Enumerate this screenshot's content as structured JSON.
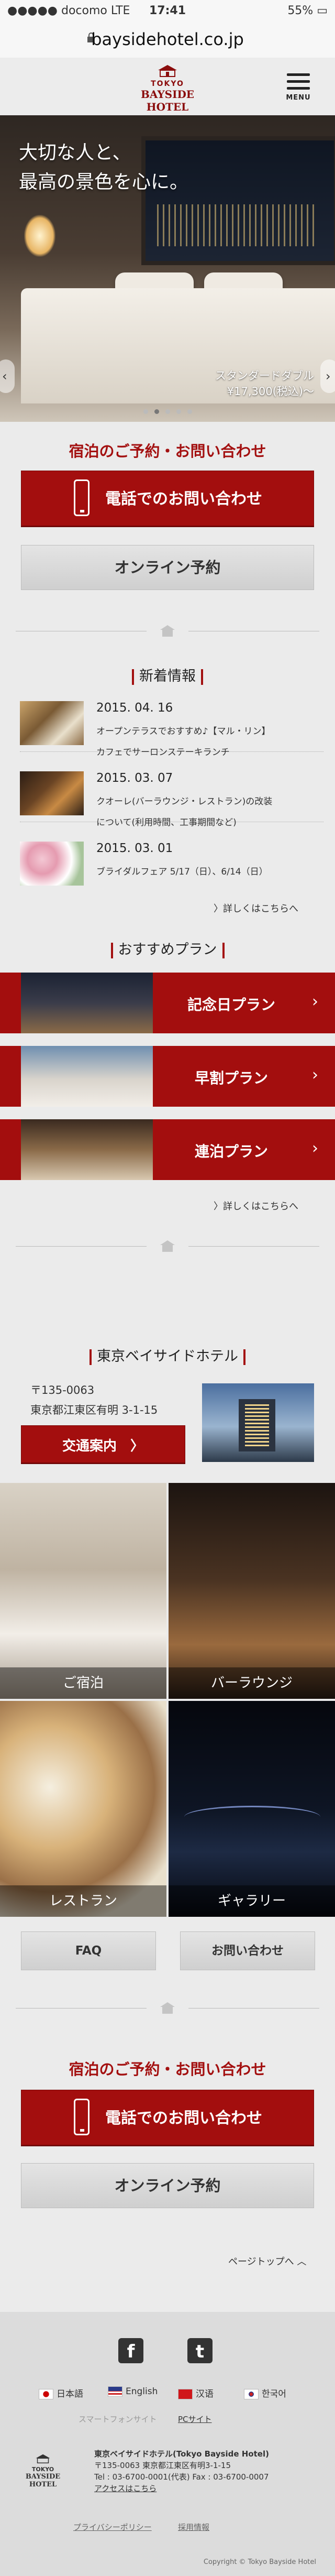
{
  "status": {
    "carrier": "●●●●● docomo",
    "network": "LTE",
    "time": "17:41",
    "battery": "55%"
  },
  "browser": {
    "url": "baysidehotel.co.jp"
  },
  "header": {
    "logo_top": "TOKYO",
    "logo_name": "BAYSIDE HOTEL",
    "menu_label": "MENU"
  },
  "hero": {
    "copy_line1": "大切な人と、",
    "copy_line2": "最高の景色を心に。",
    "room_name": "スタンダードダブル",
    "room_price": "¥17,300(税込)〜",
    "slide_count": 5,
    "active_slide": 1
  },
  "reserve": {
    "title": "宿泊のご予約・お問い合わせ",
    "phone_label": "電話でのお問い合わせ",
    "online_label": "オンライン予約"
  },
  "news": {
    "title": "新着情報",
    "more": "〉詳しくはこちらへ",
    "items": [
      {
        "date": "2015. 04. 16",
        "line1": "オープンテラスでおすすめ♪【マル・リン】",
        "line2": "カフェでサーロンステーキランチ"
      },
      {
        "date": "2015. 03. 07",
        "line1": "クオーレ(バーラウンジ・レストラン)の改装",
        "line2": "について(利用時間、工事期間など)"
      },
      {
        "date": "2015. 03. 01",
        "line1": "ブライダルフェア 5/17（日）、6/14（日）",
        "line2": ""
      }
    ]
  },
  "plans": {
    "title": "おすすめプラン",
    "more": "〉詳しくはこちらへ",
    "items": [
      {
        "label": "記念日プラン"
      },
      {
        "label": "早割プラン"
      },
      {
        "label": "連泊プラン"
      }
    ]
  },
  "hotel": {
    "title": "東京ベイサイドホテル",
    "postal": "〒135-0063",
    "address": "東京都江東区有明 3-1-15",
    "access_label": "交通案内",
    "chevron": "〉",
    "tiles": [
      {
        "label": "ご宿泊"
      },
      {
        "label": "バーラウンジ"
      },
      {
        "label": "レストラン"
      },
      {
        "label": "ギャラリー"
      }
    ]
  },
  "links": {
    "faq": "FAQ",
    "contact": "お問い合わせ"
  },
  "reserve2": {
    "title": "宿泊のご予約・お問い合わせ",
    "phone_label": "電話でのお問い合わせ",
    "online_label": "オンライン予約"
  },
  "pagetop": "ページトップへ",
  "footer": {
    "sns": [
      {
        "icon": "f"
      },
      {
        "icon": "t"
      }
    ],
    "langs": [
      "日本語",
      "English",
      "汉语",
      "한국어"
    ],
    "view_mode_sp": "スマートフォンサイト",
    "view_mode_pc": "PCサイト",
    "hotel_name": "東京ベイサイドホテル(Tokyo Bayside Hotel)",
    "address": "〒135-0063 東京都江東区有明3-1-15",
    "tel": "Tel : 03-6700-0001(代表)  Fax : 03-6700-0007",
    "access": "アクセスはこちら",
    "privacy": "プライバシーポリシー",
    "recruit": "採用情報",
    "copyright": "Copyright © Tokyo Bayside Hotel"
  },
  "colors": {
    "accent": "#a30e0e",
    "background": "#ebebeb"
  }
}
